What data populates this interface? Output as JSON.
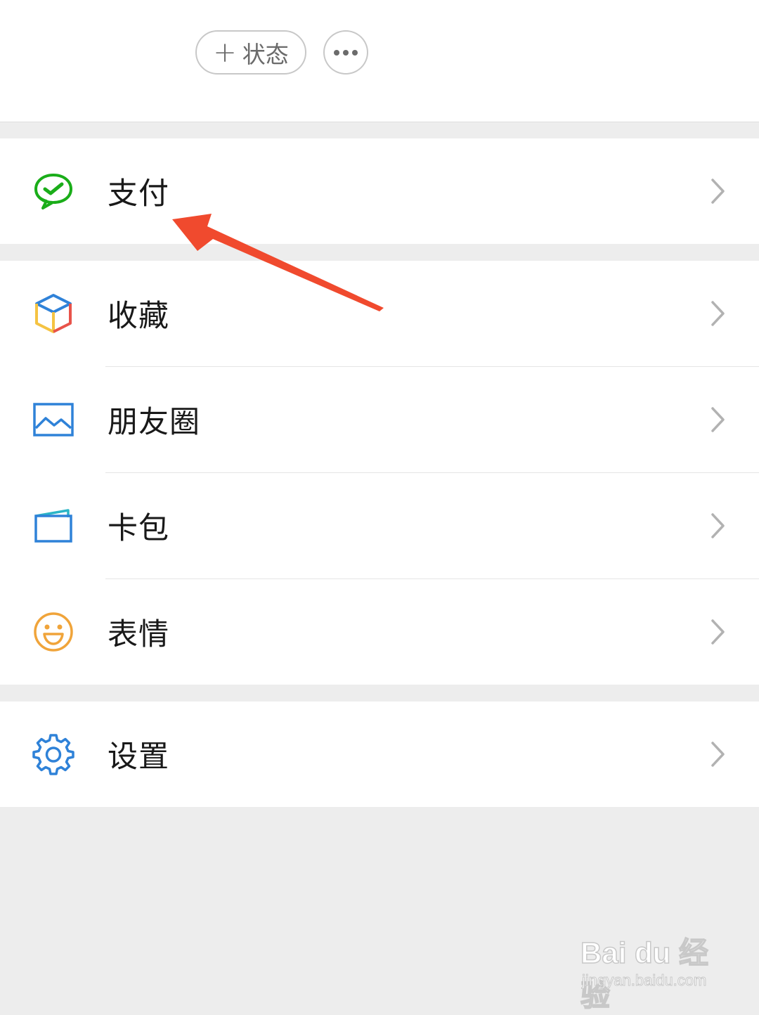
{
  "header": {
    "status_button": {
      "plus": "+",
      "label": "状态"
    },
    "more_button": {
      "icon": "more-dots-icon"
    }
  },
  "menu": {
    "pay": {
      "label": "支付",
      "icon": "wechat-pay-icon",
      "color": "#1aad19"
    },
    "favorites": {
      "label": "收藏",
      "icon": "cube-icon"
    },
    "moments": {
      "label": "朋友圈",
      "icon": "photo-icon",
      "color": "#2f82d8"
    },
    "cards": {
      "label": "卡包",
      "icon": "card-wallet-icon",
      "color": "#2f82d8"
    },
    "stickers": {
      "label": "表情",
      "icon": "smiley-icon",
      "color": "#f0a43a"
    },
    "settings": {
      "label": "设置",
      "icon": "gear-icon",
      "color": "#2f82d8"
    }
  },
  "annotation": {
    "arrow_color": "#f04a2e"
  },
  "watermark": {
    "brand": "Bai du 经验",
    "url": "jingyan.baidu.com"
  }
}
